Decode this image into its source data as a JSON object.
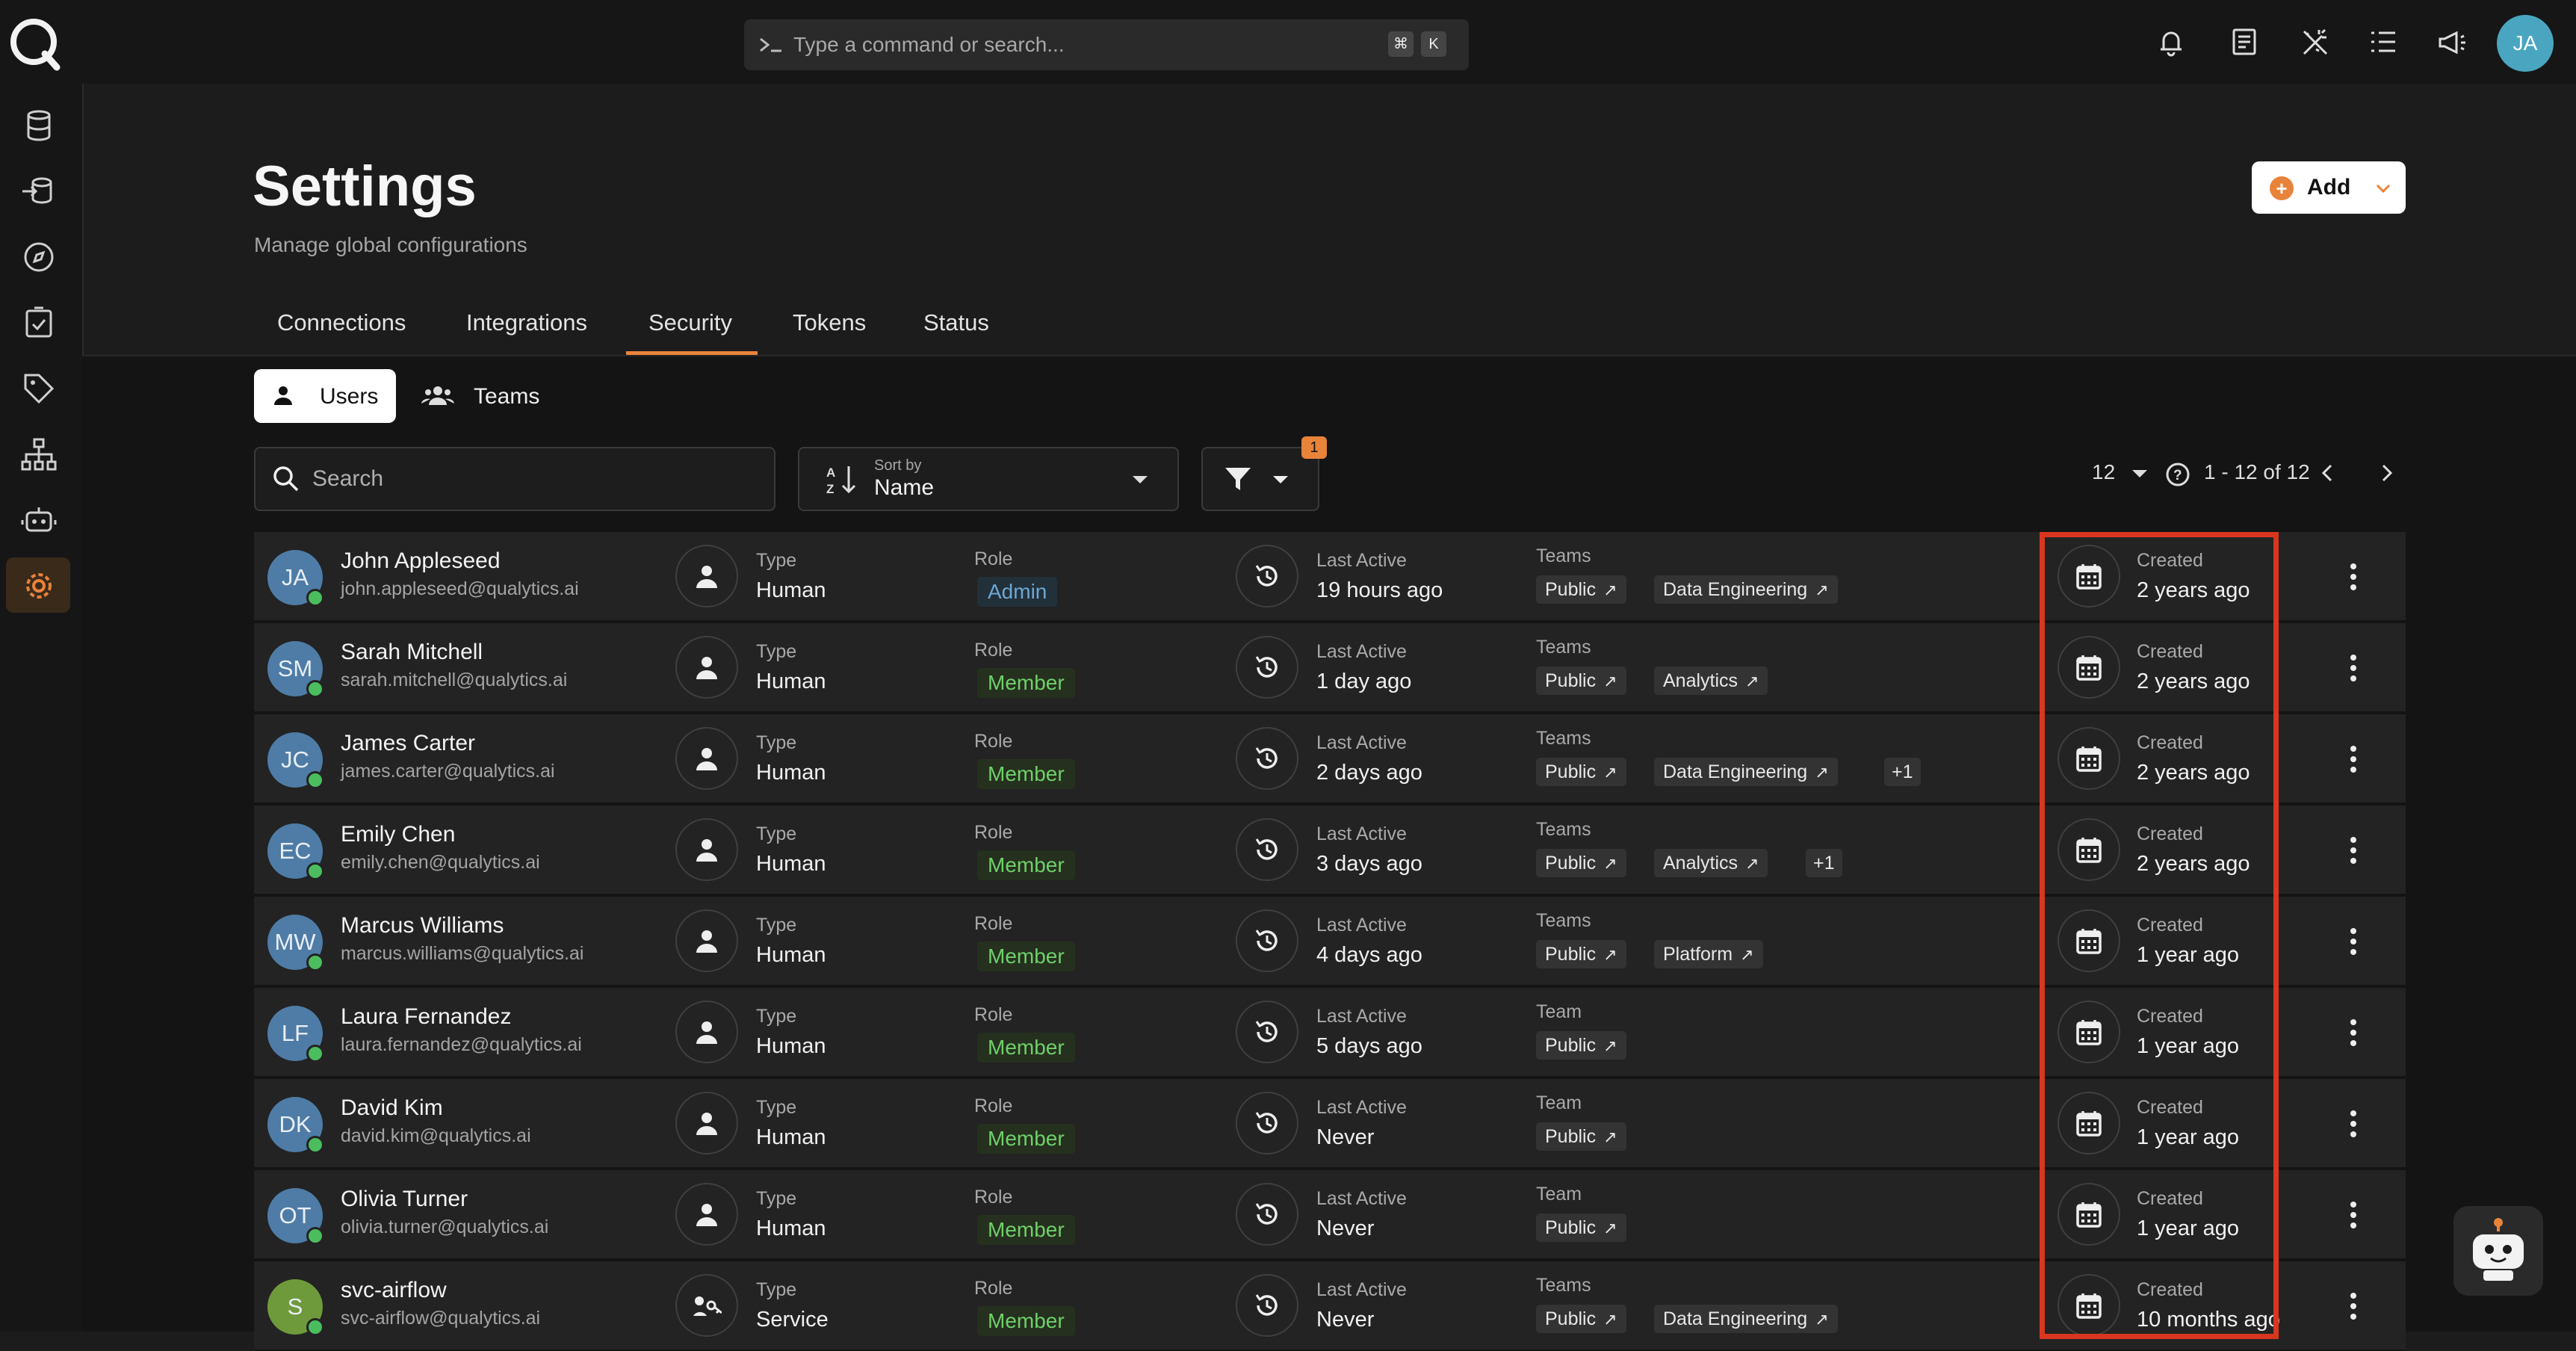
{
  "command_bar": {
    "placeholder": "Type a command or search...",
    "shortcut_keys": [
      "⌘",
      "K"
    ]
  },
  "user_avatar_initials": "JA",
  "page": {
    "title": "Settings",
    "subtitle": "Manage global configurations"
  },
  "add_button": {
    "label": "Add"
  },
  "tabs": [
    {
      "label": "Connections"
    },
    {
      "label": "Integrations"
    },
    {
      "label": "Security",
      "active": true
    },
    {
      "label": "Tokens"
    },
    {
      "label": "Status"
    }
  ],
  "subtabs": [
    {
      "label": "Users",
      "active": true
    },
    {
      "label": "Teams"
    }
  ],
  "toolbar": {
    "search_placeholder": "Search",
    "sort_caption": "Sort by",
    "sort_value": "Name",
    "filter_count": "1",
    "page_size": "12",
    "range": "1 - 12 of 12"
  },
  "columns": {
    "type": "Type",
    "role": "Role",
    "last_active": "Last Active",
    "created": "Created"
  },
  "users": [
    {
      "initials": "JA",
      "name": "John Appleseed",
      "email": "john.appleseed@qualytics.ai",
      "type": "Human",
      "role": "Admin",
      "last_active": "19 hours ago",
      "teams_label": "Teams",
      "teams": [
        "Public",
        "Data Engineering"
      ],
      "extra": "",
      "created": "2 years ago"
    },
    {
      "initials": "SM",
      "name": "Sarah Mitchell",
      "email": "sarah.mitchell@qualytics.ai",
      "type": "Human",
      "role": "Member",
      "last_active": "1 day ago",
      "teams_label": "Teams",
      "teams": [
        "Public",
        "Analytics"
      ],
      "extra": "",
      "created": "2 years ago"
    },
    {
      "initials": "JC",
      "name": "James Carter",
      "email": "james.carter@qualytics.ai",
      "type": "Human",
      "role": "Member",
      "last_active": "2 days ago",
      "teams_label": "Teams",
      "teams": [
        "Public",
        "Data Engineering"
      ],
      "extra": "+1",
      "created": "2 years ago"
    },
    {
      "initials": "EC",
      "name": "Emily Chen",
      "email": "emily.chen@qualytics.ai",
      "type": "Human",
      "role": "Member",
      "last_active": "3 days ago",
      "teams_label": "Teams",
      "teams": [
        "Public",
        "Analytics"
      ],
      "extra": "+1",
      "created": "2 years ago"
    },
    {
      "initials": "MW",
      "name": "Marcus Williams",
      "email": "marcus.williams@qualytics.ai",
      "type": "Human",
      "role": "Member",
      "last_active": "4 days ago",
      "teams_label": "Teams",
      "teams": [
        "Public",
        "Platform"
      ],
      "extra": "",
      "created": "1 year ago"
    },
    {
      "initials": "LF",
      "name": "Laura Fernandez",
      "email": "laura.fernandez@qualytics.ai",
      "type": "Human",
      "role": "Member",
      "last_active": "5 days ago",
      "teams_label": "Team",
      "teams": [
        "Public"
      ],
      "extra": "",
      "created": "1 year ago"
    },
    {
      "initials": "DK",
      "name": "David Kim",
      "email": "david.kim@qualytics.ai",
      "type": "Human",
      "role": "Member",
      "last_active": "Never",
      "teams_label": "Team",
      "teams": [
        "Public"
      ],
      "extra": "",
      "created": "1 year ago"
    },
    {
      "initials": "OT",
      "name": "Olivia Turner",
      "email": "olivia.turner@qualytics.ai",
      "type": "Human",
      "role": "Member",
      "last_active": "Never",
      "teams_label": "Team",
      "teams": [
        "Public"
      ],
      "extra": "",
      "created": "1 year ago"
    },
    {
      "initials": "S",
      "name": "svc-airflow",
      "email": "svc-airflow@qualytics.ai",
      "type": "Service",
      "role": "Member",
      "last_active": "Never",
      "teams_label": "Teams",
      "teams": [
        "Public",
        "Data Engineering"
      ],
      "extra": "",
      "created": "10 months ago"
    }
  ],
  "colors": {
    "accent": "#e8833a",
    "highlight": "#d9361f",
    "member": "#6fd069",
    "admin": "#6ca8d2"
  }
}
